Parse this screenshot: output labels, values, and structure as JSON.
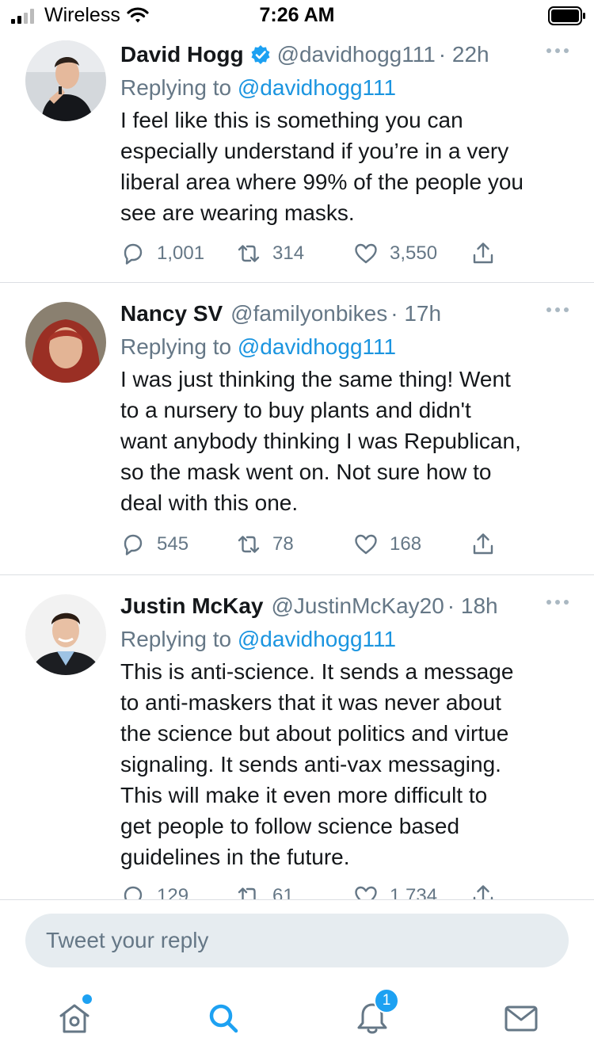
{
  "status_bar": {
    "carrier": "Wireless",
    "time": "7:26 AM"
  },
  "tweets": [
    {
      "name": "David Hogg",
      "verified": true,
      "handle": "@davidhogg111",
      "time": "· 22h",
      "reply_prefix": "Replying to ",
      "reply_to": "@davidhogg111",
      "lines": [
        "I feel like this is something you can",
        "especially understand if you’re in a very",
        "liberal area where 99% of the people you",
        "see are wearing masks."
      ],
      "replies": "1,001",
      "retweets": "314",
      "likes": "3,550"
    },
    {
      "name": "Nancy SV",
      "verified": false,
      "handle": "@familyonbikes",
      "time": "· 17h",
      "reply_prefix": "Replying to ",
      "reply_to": "@davidhogg111",
      "lines": [
        "I was just thinking the same thing! Went",
        "to a nursery to buy plants and didn't",
        "want anybody thinking I was Republican,",
        "so the mask went on.  Not sure how to",
        "deal with this one."
      ],
      "replies": "545",
      "retweets": "78",
      "likes": "168"
    },
    {
      "name": "Justin McKay",
      "verified": false,
      "handle": "@JustinMcKay20",
      "time": "· 18h",
      "reply_prefix": "Replying to ",
      "reply_to": "@davidhogg111",
      "lines": [
        "This is anti-science. It sends a message",
        "to anti-maskers that it was never about",
        "the science but about politics and virtue",
        "signaling. It sends anti-vax messaging.",
        "This will make it even more difficult to",
        "get people to follow science based",
        "guidelines in the future."
      ],
      "replies": "129",
      "retweets": "61",
      "likes": "1,734"
    }
  ],
  "reply_bar": {
    "placeholder": "Tweet your reply"
  },
  "tab_bar": {
    "notification_count": "1"
  },
  "colors": {
    "accent": "#1da1f2",
    "link": "#1b95e0",
    "secondary_text": "#657786",
    "divider": "#dcdfe3"
  },
  "icons": [
    "signal-icon",
    "wifi-icon",
    "battery-icon",
    "verified-icon",
    "more-icon",
    "reply-icon",
    "retweet-icon",
    "like-icon",
    "share-icon",
    "home-icon",
    "search-icon",
    "notifications-icon",
    "messages-icon"
  ]
}
